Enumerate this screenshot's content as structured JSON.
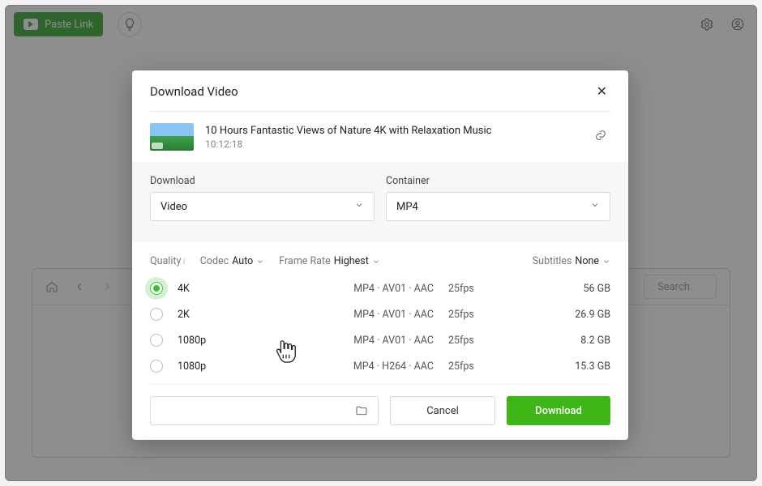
{
  "topbar": {
    "paste_label": "Paste Link"
  },
  "browser": {
    "search_label": "Search"
  },
  "dialog": {
    "title": "Download Video",
    "video": {
      "title": "10 Hours Fantastic Views of Nature 4K with Relaxation Music",
      "duration": "10:12:18"
    },
    "download_label": "Download",
    "container_label": "Container",
    "download_value": "Video",
    "container_value": "MP4",
    "quality_label": "Quality",
    "codec_label": "Codec",
    "codec_value": "Auto",
    "framerate_label": "Frame Rate",
    "framerate_value": "Highest",
    "subtitles_label": "Subtitles",
    "subtitles_value": "None",
    "qualities": [
      {
        "res": "4K",
        "codec": "MP4 · AV01 · AAC",
        "fps": "25fps",
        "size": "56 GB"
      },
      {
        "res": "2K",
        "codec": "MP4 · AV01 · AAC",
        "fps": "25fps",
        "size": "26.9 GB"
      },
      {
        "res": "1080p",
        "codec": "MP4 · AV01 · AAC",
        "fps": "25fps",
        "size": "8.2 GB"
      },
      {
        "res": "1080p",
        "codec": "MP4 · H264 · AAC",
        "fps": "25fps",
        "size": "15.3 GB"
      }
    ],
    "cancel_label": "Cancel",
    "download_button_label": "Download"
  }
}
